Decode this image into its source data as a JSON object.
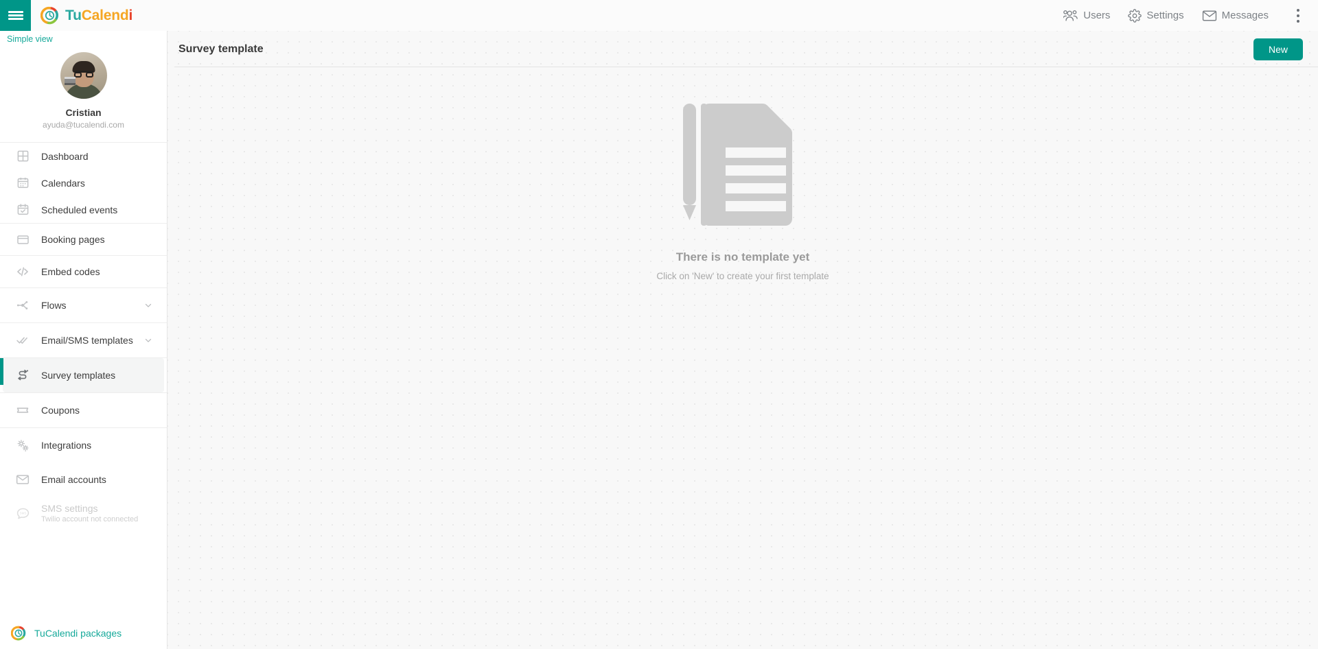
{
  "topbar": {
    "menu_icon": "hamburger-icon",
    "brand": {
      "part1": "Tu",
      "part2": "Calend",
      "part3": "i"
    },
    "nav": [
      {
        "label": "Users",
        "icon": "users-icon"
      },
      {
        "label": "Settings",
        "icon": "gear-icon"
      },
      {
        "label": "Messages",
        "icon": "envelope-icon"
      }
    ],
    "overflow_icon": "kebab-menu-icon"
  },
  "sidebar": {
    "simple_view": "Simple view",
    "profile": {
      "name": "Cristian",
      "email": "ayuda@tucalendi.com",
      "avatar_icon": "avatar-photo"
    },
    "groups": [
      {
        "items": [
          {
            "label": "Dashboard",
            "icon": "grid-icon",
            "active": false
          },
          {
            "label": "Calendars",
            "icon": "calendar-icon",
            "active": false
          },
          {
            "label": "Scheduled events",
            "icon": "calendar-check-icon",
            "active": false
          }
        ]
      },
      {
        "items": [
          {
            "label": "Booking pages",
            "icon": "window-icon",
            "active": false
          }
        ]
      },
      {
        "items": [
          {
            "label": "Embed codes",
            "icon": "code-icon",
            "active": false
          }
        ]
      },
      {
        "items": [
          {
            "label": "Flows",
            "icon": "flow-nodes-icon",
            "active": false,
            "chevron": true
          }
        ]
      },
      {
        "items": [
          {
            "label": "Email/SMS templates",
            "icon": "double-check-icon",
            "active": false,
            "chevron": true
          }
        ]
      },
      {
        "items": [
          {
            "label": "Survey templates",
            "icon": "survey-arrows-icon",
            "active": true
          }
        ]
      },
      {
        "items": [
          {
            "label": "Coupons",
            "icon": "ticket-icon",
            "active": false
          }
        ]
      },
      {
        "items": [
          {
            "label": "Integrations",
            "icon": "gears-icon",
            "active": false
          },
          {
            "label": "Email accounts",
            "icon": "envelope-icon",
            "active": false
          },
          {
            "label": "SMS settings",
            "sub": "Twilio account not connected",
            "icon": "sms-bubble-icon",
            "active": false,
            "disabled": true
          }
        ]
      }
    ],
    "footer": {
      "label": "TuCalendi packages",
      "icon": "tucalendi-logo-icon"
    }
  },
  "main": {
    "page_title": "Survey template",
    "new_button": "New",
    "empty_state": {
      "illustration": "document-with-pencil-icon",
      "title": "There is no template yet",
      "subtitle": "Click on 'New' to create your first template"
    }
  },
  "colors": {
    "accent_teal": "#009688",
    "brand_teal": "#2aa9a0",
    "brand_amber": "#f5a623",
    "brand_red": "#e8432c",
    "link_teal": "#16a99a",
    "page_bg": "#f8f8f8",
    "illustration_gray": "#cccccc"
  }
}
